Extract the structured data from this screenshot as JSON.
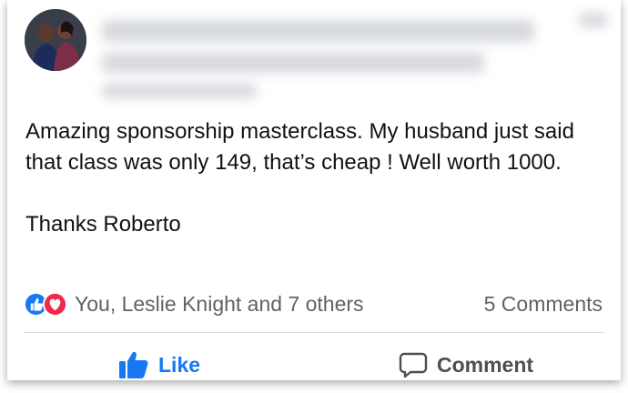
{
  "post": {
    "text": "Amazing sponsorship masterclass. My husband just said that class was only 149, that’s cheap ! Well worth 1000.\n\nThanks Roberto"
  },
  "reactions": {
    "summary": "You, Leslie Knight and 7 others",
    "icons": [
      "like-icon",
      "love-icon"
    ]
  },
  "comments": {
    "count_label": "5 Comments"
  },
  "actions": {
    "like_label": "Like",
    "comment_label": "Comment"
  },
  "colors": {
    "like_blue": "#1877f2",
    "love_red": "#f02849",
    "secondary_text": "#5f6368"
  }
}
